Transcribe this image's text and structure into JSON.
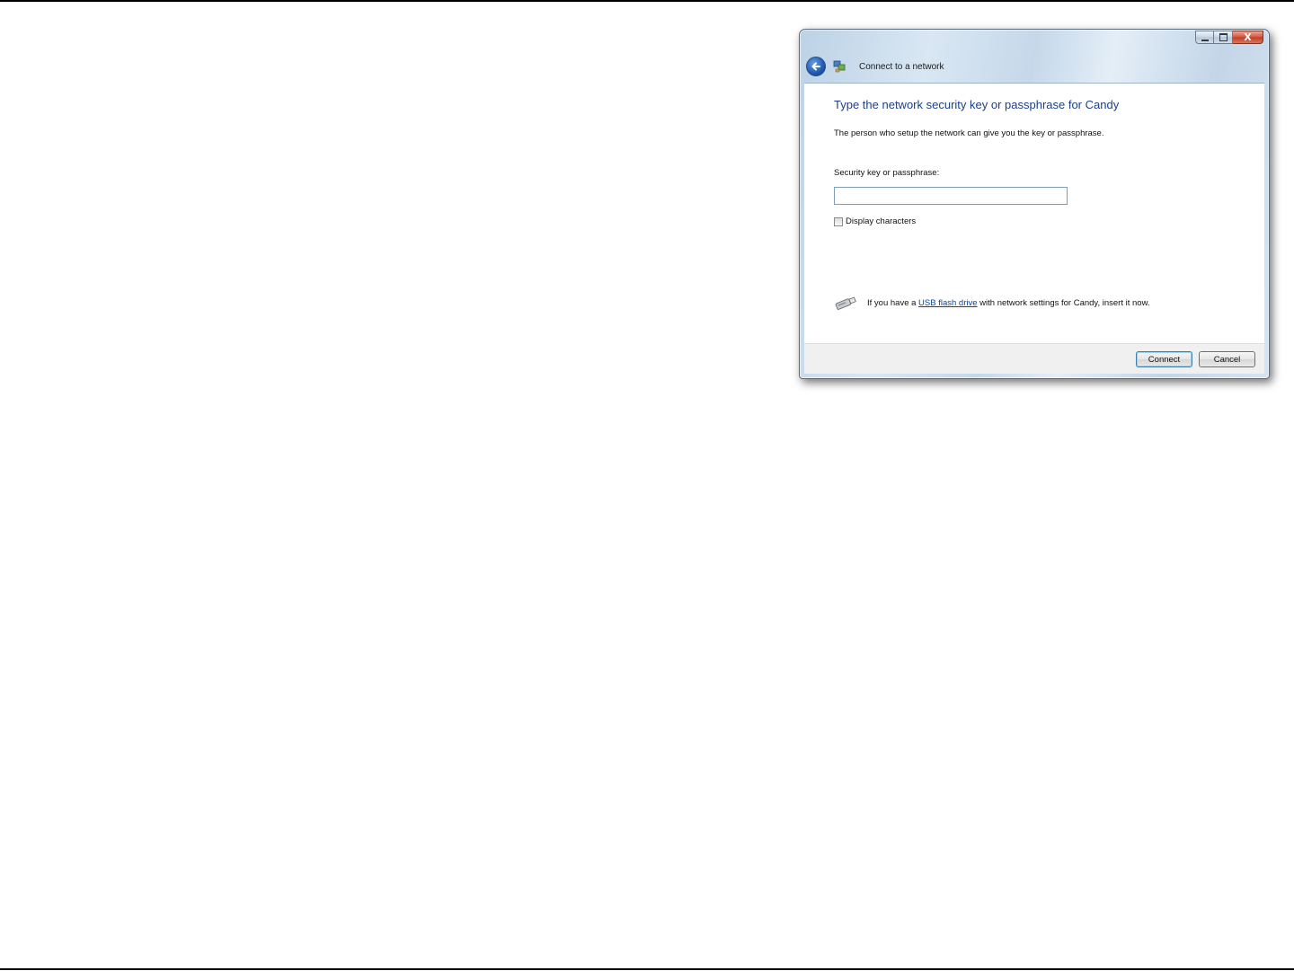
{
  "window": {
    "title": "Connect to a network",
    "close_glyph": "X"
  },
  "content": {
    "heading": "Type the network security key or passphrase for Candy",
    "description": "The person who setup the network can give you the key or passphrase.",
    "key_label": "Security key or passphrase:",
    "key_value": "",
    "display_characters_label": "Display characters",
    "display_characters_checked": false,
    "usb": {
      "prefix": "If you have a ",
      "link_text": "USB flash drive",
      "suffix": " with network settings for Candy, insert it now."
    }
  },
  "footer": {
    "connect_label": "Connect",
    "cancel_label": "Cancel"
  },
  "icons": {
    "back": "back-arrow-icon",
    "network": "network-icon",
    "usb": "usb-drive-icon"
  },
  "colors": {
    "heading": "#1c3f8c",
    "link": "#0645ad",
    "close_button": "#c23b22"
  }
}
